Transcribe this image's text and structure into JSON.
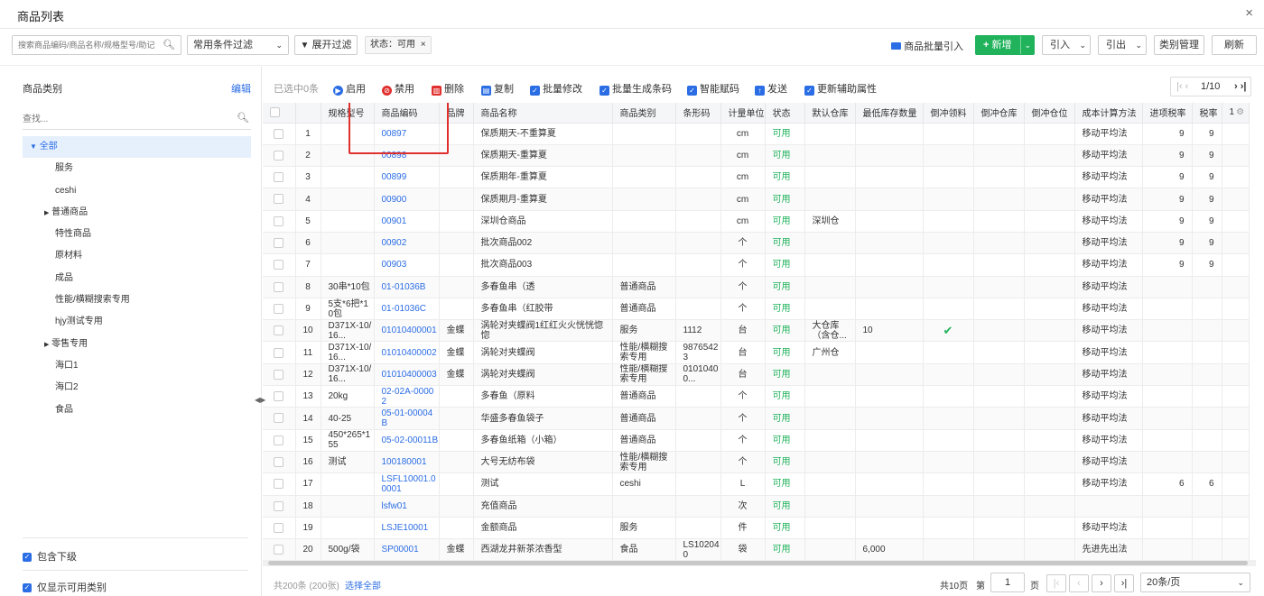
{
  "window": {
    "title": "商品列表",
    "close": "×"
  },
  "toolbar": {
    "search_placeholder": "搜索商品编码/商品名称/规格型号/助记",
    "filter_select": "常用条件过滤",
    "expand_filter": "展开过滤",
    "status_tag": "状态：可用",
    "batch_import": "商品批量引入",
    "add": "新增",
    "import": "引入",
    "export": "引出",
    "category_manage": "类别管理",
    "refresh": "刷新"
  },
  "sidebar": {
    "heading": "商品类别",
    "edit": "编辑",
    "search_placeholder": "查找...",
    "items": [
      {
        "label": "全部",
        "arrow": "▼"
      },
      {
        "label": "服务",
        "arrow": ""
      },
      {
        "label": "ceshi",
        "arrow": ""
      },
      {
        "label": "普通商品",
        "arrow": "▶"
      },
      {
        "label": "特性商品",
        "arrow": ""
      },
      {
        "label": "原材料",
        "arrow": ""
      },
      {
        "label": "成品",
        "arrow": ""
      },
      {
        "label": "性能/横糊搜索专用",
        "arrow": ""
      },
      {
        "label": "hjy测试专用",
        "arrow": ""
      },
      {
        "label": "零售专用",
        "arrow": "▶"
      },
      {
        "label": "海口1",
        "arrow": ""
      },
      {
        "label": "海口2",
        "arrow": ""
      },
      {
        "label": "食品",
        "arrow": ""
      }
    ],
    "include_children": "包含下级",
    "only_available": "仅显示可用类别"
  },
  "actions": {
    "selected": "已选中0条",
    "enable": "启用",
    "disable": "禁用",
    "delete": "删除",
    "copy": "复制",
    "batch_edit": "批量修改",
    "batch_barcode": "批量生成条码",
    "smart_code": "智能赋码",
    "send": "发送",
    "update_attr": "更新辅助属性",
    "page_indicator": "1/10"
  },
  "table": {
    "columns": [
      "",
      "",
      "规格型号",
      "商品编码",
      "品牌",
      "商品名称",
      "商品类别",
      "条形码",
      "计量单位",
      "状态",
      "默认仓库",
      "最低库存数量",
      "倒冲领料",
      "倒冲仓库",
      "倒冲仓位",
      "成本计算方法",
      "进项税率",
      "税率",
      "1"
    ],
    "rows": [
      [
        "1",
        "",
        "00897",
        "",
        "保质期天-不重算夏",
        "",
        "",
        "cm",
        "可用",
        "",
        "",
        "",
        "",
        "",
        "移动平均法",
        "9",
        "9"
      ],
      [
        "2",
        "",
        "00898",
        "",
        "保质期天-重算夏",
        "",
        "",
        "cm",
        "可用",
        "",
        "",
        "",
        "",
        "",
        "移动平均法",
        "9",
        "9"
      ],
      [
        "3",
        "",
        "00899",
        "",
        "保质期年-重算夏",
        "",
        "",
        "cm",
        "可用",
        "",
        "",
        "",
        "",
        "",
        "移动平均法",
        "9",
        "9"
      ],
      [
        "4",
        "",
        "00900",
        "",
        "保质期月-重算夏",
        "",
        "",
        "cm",
        "可用",
        "",
        "",
        "",
        "",
        "",
        "移动平均法",
        "9",
        "9"
      ],
      [
        "5",
        "",
        "00901",
        "",
        "深圳仓商品",
        "",
        "",
        "cm",
        "可用",
        "深圳仓",
        "",
        "",
        "",
        "",
        "移动平均法",
        "9",
        "9"
      ],
      [
        "6",
        "",
        "00902",
        "",
        "批次商品002",
        "",
        "",
        "个",
        "可用",
        "",
        "",
        "",
        "",
        "",
        "移动平均法",
        "9",
        "9"
      ],
      [
        "7",
        "",
        "00903",
        "",
        "批次商品003",
        "",
        "",
        "个",
        "可用",
        "",
        "",
        "",
        "",
        "",
        "移动平均法",
        "9",
        "9"
      ],
      [
        "8",
        "30串*10包",
        "01-01036B",
        "",
        "多春鱼串（透",
        "普通商品",
        "",
        "个",
        "可用",
        "",
        "",
        "",
        "",
        "",
        "移动平均法",
        "",
        ""
      ],
      [
        "9",
        "5支*6把*10包",
        "01-01036C",
        "",
        "多春鱼串（红胶带",
        "普通商品",
        "",
        "个",
        "可用",
        "",
        "",
        "",
        "",
        "",
        "移动平均法",
        "",
        ""
      ],
      [
        "10",
        "D371X-10/16...",
        "01010400001",
        "金蝶",
        "涡轮对夹蝶阀1红红火火恍恍惚惚",
        "服务",
        "1112",
        "台",
        "可用",
        "大仓库（含仓...",
        "10",
        "✔",
        "",
        "",
        "移动平均法",
        "",
        ""
      ],
      [
        "11",
        "D371X-10/16...",
        "01010400002",
        "金蝶",
        "涡轮对夹蝶阀",
        "性能/横糊搜索专用",
        "98765423",
        "台",
        "可用",
        "广州仓",
        "",
        "",
        "",
        "",
        "移动平均法",
        "",
        ""
      ],
      [
        "12",
        "D371X-10/16...",
        "01010400003",
        "金蝶",
        "涡轮对夹蝶阀",
        "性能/横糊搜索专用",
        "01010400...",
        "台",
        "可用",
        "",
        "",
        "",
        "",
        "",
        "移动平均法",
        "",
        ""
      ],
      [
        "13",
        "20kg",
        "02-02A-00002",
        "",
        "多春鱼（原料",
        "普通商品",
        "",
        "个",
        "可用",
        "",
        "",
        "",
        "",
        "",
        "移动平均法",
        "",
        ""
      ],
      [
        "14",
        "40-25",
        "05-01-00004B",
        "",
        "华盛多春鱼袋子",
        "普通商品",
        "",
        "个",
        "可用",
        "",
        "",
        "",
        "",
        "",
        "移动平均法",
        "",
        ""
      ],
      [
        "15",
        "450*265*155",
        "05-02-00011B",
        "",
        "多春鱼纸箱（小箱）",
        "普通商品",
        "",
        "个",
        "可用",
        "",
        "",
        "",
        "",
        "",
        "移动平均法",
        "",
        ""
      ],
      [
        "16",
        "测试",
        "100180001",
        "",
        "大号无纺布袋",
        "性能/横糊搜索专用",
        "",
        "个",
        "可用",
        "",
        "",
        "",
        "",
        "",
        "移动平均法",
        "",
        ""
      ],
      [
        "17",
        "",
        "LSFL10001.00001",
        "",
        "测试",
        "ceshi",
        "",
        "L",
        "可用",
        "",
        "",
        "",
        "",
        "",
        "移动平均法",
        "6",
        "6"
      ],
      [
        "18",
        "",
        "lsfw01",
        "",
        "充值商品",
        "",
        "",
        "次",
        "可用",
        "",
        "",
        "",
        "",
        "",
        "",
        "",
        ""
      ],
      [
        "19",
        "",
        "LSJE10001",
        "",
        "金额商品",
        "服务",
        "",
        "件",
        "可用",
        "",
        "",
        "",
        "",
        "",
        "移动平均法",
        "",
        ""
      ],
      [
        "20",
        "500g/袋",
        "SP00001",
        "金蝶",
        "西湖龙井新茶浓香型",
        "食品",
        "LS102040",
        "袋",
        "可用",
        "",
        "6,000",
        "",
        "",
        "",
        "先进先出法",
        "",
        ""
      ]
    ]
  },
  "footer": {
    "total": "共200条 (200张)",
    "select_all": "选择全部",
    "pages": "共10页",
    "page_prefix": "第",
    "page_value": "1",
    "page_suffix": "页",
    "page_size": "20条/页"
  },
  "colors": {
    "accent": "#2b6de5",
    "green": "#21b35c",
    "highlight": "#e0302e"
  }
}
